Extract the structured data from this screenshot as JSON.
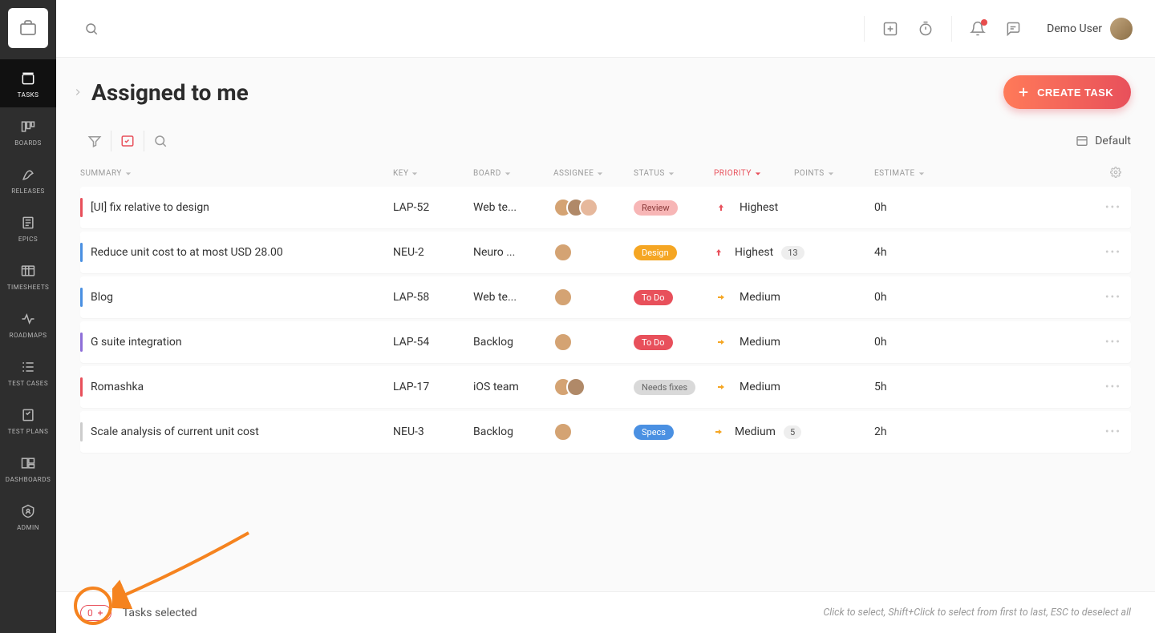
{
  "sidebar": {
    "items": [
      {
        "label": "TASKS"
      },
      {
        "label": "BOARDS"
      },
      {
        "label": "RELEASES"
      },
      {
        "label": "EPICS"
      },
      {
        "label": "TIMESHEETS"
      },
      {
        "label": "ROADMAPS"
      },
      {
        "label": "TEST CASES"
      },
      {
        "label": "TEST PLANS"
      },
      {
        "label": "DASHBOARDS"
      },
      {
        "label": "ADMIN"
      }
    ]
  },
  "topbar": {
    "user_name": "Demo User"
  },
  "page": {
    "title": "Assigned to me",
    "create_button": "CREATE TASK",
    "view_label": "Default"
  },
  "columns": {
    "summary": "SUMMARY",
    "key": "KEY",
    "board": "BOARD",
    "assignee": "ASSIGNEE",
    "status": "STATUS",
    "priority": "PRIORITY",
    "points": "POINTS",
    "estimate": "ESTIMATE"
  },
  "rows": [
    {
      "stripe": "#e8505b",
      "summary": "[UI] fix relative to design",
      "key": "LAP-52",
      "board": "Web te...",
      "assignees": 3,
      "status": {
        "label": "Review",
        "bg": "#f7b6b6",
        "color": "#8b3a3a"
      },
      "priority": {
        "label": "Highest",
        "arrow": "up",
        "color": "#e8505b"
      },
      "points": "",
      "estimate": "0h"
    },
    {
      "stripe": "#4a90e2",
      "summary": "Reduce unit cost to at most USD 28.00",
      "key": "NEU-2",
      "board": "Neuro ...",
      "assignees": 1,
      "status": {
        "label": "Design",
        "bg": "#f5a623",
        "color": "#fff"
      },
      "priority": {
        "label": "Highest",
        "arrow": "up",
        "color": "#e8505b"
      },
      "points": "13",
      "estimate": "4h"
    },
    {
      "stripe": "#4a90e2",
      "summary": "Blog",
      "key": "LAP-58",
      "board": "Web te...",
      "assignees": 1,
      "status": {
        "label": "To Do",
        "bg": "#e8505b",
        "color": "#fff"
      },
      "priority": {
        "label": "Medium",
        "arrow": "right",
        "color": "#f5a623"
      },
      "points": "",
      "estimate": "0h"
    },
    {
      "stripe": "#8e6fd8",
      "summary": "G suite integration",
      "key": "LAP-54",
      "board": "Backlog",
      "assignees": 1,
      "status": {
        "label": "To Do",
        "bg": "#e8505b",
        "color": "#fff"
      },
      "priority": {
        "label": "Medium",
        "arrow": "right",
        "color": "#f5a623"
      },
      "points": "",
      "estimate": "0h"
    },
    {
      "stripe": "#e8505b",
      "summary": "Romashka",
      "key": "LAP-17",
      "board": "iOS team",
      "assignees": 2,
      "status": {
        "label": "Needs fixes",
        "bg": "#d9d9d9",
        "color": "#666"
      },
      "priority": {
        "label": "Medium",
        "arrow": "right",
        "color": "#f5a623"
      },
      "points": "",
      "estimate": "5h"
    },
    {
      "stripe": "#cccccc",
      "summary": "Scale analysis of current unit cost",
      "key": "NEU-3",
      "board": "Backlog",
      "assignees": 1,
      "status": {
        "label": "Specs",
        "bg": "#4a90e2",
        "color": "#fff"
      },
      "priority": {
        "label": "Medium",
        "arrow": "right",
        "color": "#f5a623"
      },
      "points": "5",
      "estimate": "2h"
    }
  ],
  "footer": {
    "selected_count": "0",
    "selected_label": "Tasks selected",
    "hint": "Click to select, Shift+Click to select from first to last, ESC to deselect all"
  }
}
